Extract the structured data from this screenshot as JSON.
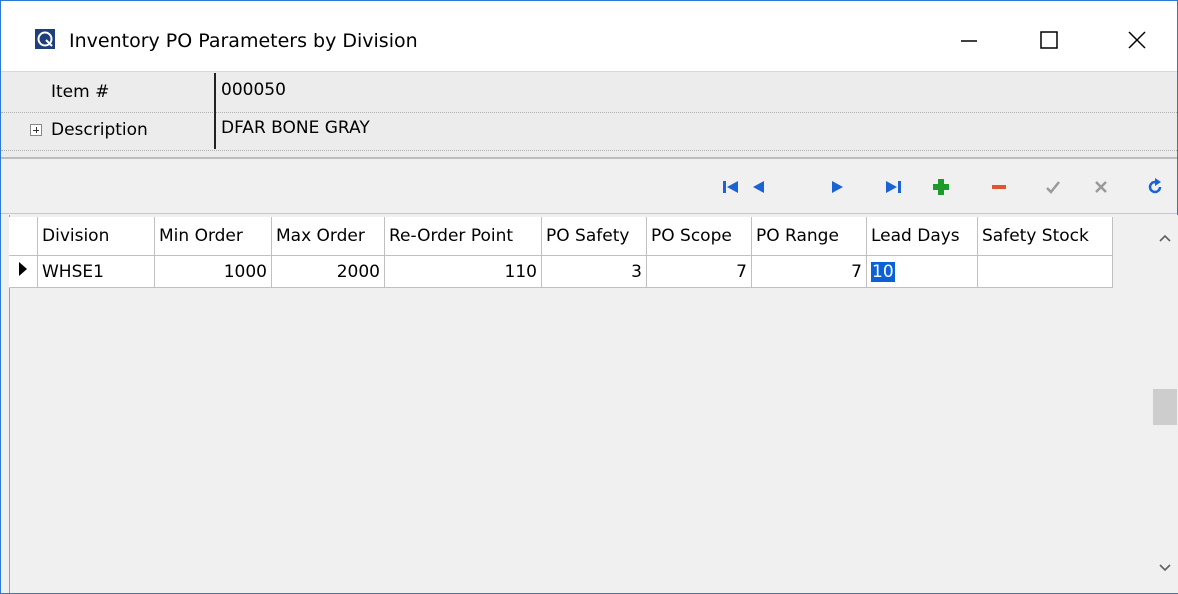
{
  "window": {
    "title": "Inventory PO Parameters by Division",
    "controls": {
      "minimize": "—",
      "maximize": "☐",
      "close": "✕"
    }
  },
  "header": {
    "item_label": "Item #",
    "item_value": "000050",
    "description_label": "Description",
    "description_value": "DFAR BONE GRAY"
  },
  "toolbar": {
    "buttons": [
      "first-record-icon",
      "prior-record-icon",
      "next-record-icon",
      "last-record-icon",
      "insert-icon",
      "delete-icon",
      "post-icon",
      "cancel-icon",
      "refresh-icon"
    ],
    "colors": {
      "nav": "#1b63d3",
      "insert": "#1c9a2a",
      "delete": "#e2542e",
      "disabled": "#9a9a9a",
      "refresh": "#1b63d3"
    }
  },
  "grid": {
    "columns": [
      "Division",
      "Min Order",
      "Max Order",
      "Re-Order Point",
      "PO Safety",
      "PO Scope",
      "PO Range",
      "Lead Days",
      "Safety Stock"
    ],
    "rows": [
      {
        "division": "WHSE1",
        "min_order": "1000",
        "max_order": "2000",
        "reorder_point": "110",
        "po_safety": "3",
        "po_scope": "7",
        "po_range": "7",
        "lead_days": "10",
        "safety_stock": ""
      }
    ],
    "selected_cell": "lead_days"
  }
}
